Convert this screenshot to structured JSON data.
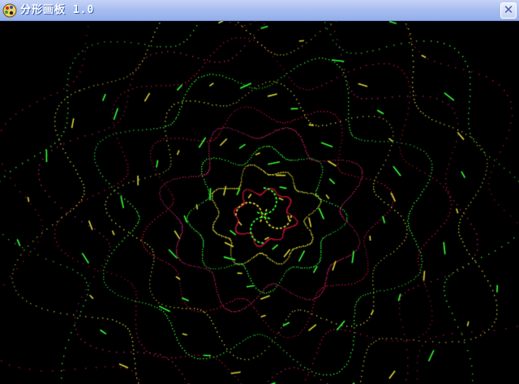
{
  "window": {
    "title": "分形画板  1.0",
    "close_glyph": "✕",
    "icon": "paint-palette-icon",
    "title_bar_color": "#a9bff0"
  },
  "canvas": {
    "background": "#000000",
    "content": "spiral-fractal-dot-pattern",
    "colors": {
      "green": "#33ff33",
      "yellow": "#d9d433",
      "red": "#cc1133",
      "magenta": "#cc2266"
    }
  }
}
